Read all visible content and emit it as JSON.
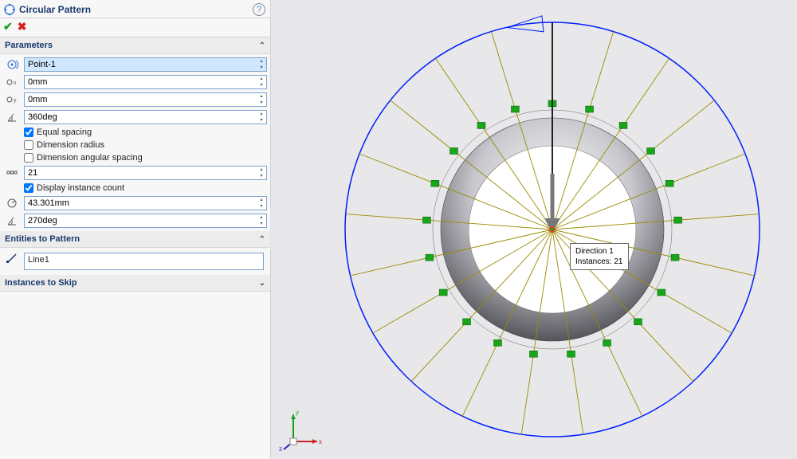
{
  "feature": {
    "title": "Circular Pattern"
  },
  "sections": {
    "parameters": {
      "label": "Parameters",
      "expanded": true
    },
    "entities": {
      "label": "Entities to Pattern",
      "expanded": true
    },
    "skip": {
      "label": "Instances to Skip",
      "expanded": false
    }
  },
  "fields": {
    "center": {
      "value": "Point-1"
    },
    "offsetX": {
      "value": "0mm"
    },
    "offsetY": {
      "value": "0mm"
    },
    "angle": {
      "value": "360deg"
    },
    "count": {
      "value": "21"
    },
    "radius": {
      "value": "43.301mm"
    },
    "rotation": {
      "value": "270deg"
    }
  },
  "checks": {
    "equalSpacing": {
      "label": "Equal spacing",
      "checked": true
    },
    "dimensionRadius": {
      "label": "Dimension radius",
      "checked": false
    },
    "dimensionAngular": {
      "label": "Dimension angular spacing",
      "checked": false
    },
    "displayCount": {
      "label": "Display instance count",
      "checked": true
    }
  },
  "entities": {
    "item0": "Line1"
  },
  "callout": {
    "line1": "Direction 1",
    "line2_label": "Instances:",
    "line2_value": "21"
  },
  "axis": {
    "x": "x",
    "y": "y",
    "z": "z"
  },
  "chart_data": {
    "type": "radial-pattern",
    "instances": 21,
    "total_angle_deg": 360,
    "seed_radius_mm": 43.301,
    "seed_angle_deg": 270,
    "equal_spacing": true
  },
  "colors": {
    "panelAccent": "#1a3a6e",
    "ok": "#19a119",
    "cancel": "#d62222",
    "previewCircle": "#0020ff",
    "patternLine": "#9a8b00",
    "marker": "#17a617",
    "ring": "#6b6b73"
  }
}
